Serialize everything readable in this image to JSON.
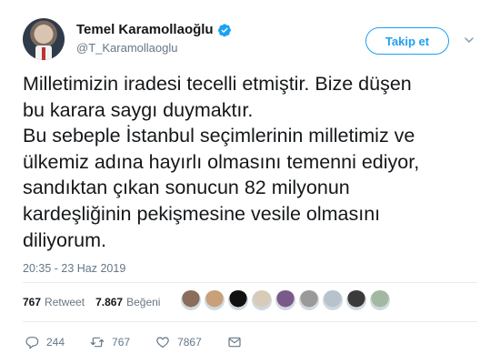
{
  "author": {
    "display_name": "Temel Karamollaoğlu",
    "handle": "@T_Karamollaoglu",
    "verified": true
  },
  "follow_button": {
    "label": "Takip et"
  },
  "tweet": {
    "lines": [
      "Milletimizin iradesi tecelli etmiştir. Bize düşen",
      "bu karara saygı duymaktır.",
      "Bu sebeple İstanbul seçimlerinin milletimiz ve",
      "ülkemiz adına hayırlı olmasını temenni ediyor,",
      "sandıktan çıkan sonucun 82 milyonun",
      "kardeşliğinin pekişmesine vesile olmasını",
      "diliyorum."
    ],
    "timestamp": "20:35 - 23 Haz 2019"
  },
  "stats": {
    "retweets_count": "767",
    "retweets_label": "Retweet",
    "likes_count": "7.867",
    "likes_label": "Beğeni"
  },
  "likers": [
    {
      "color": "#8a6d5a"
    },
    {
      "color": "#c9a07a"
    },
    {
      "color": "#111111"
    },
    {
      "color": "#d8cbb8"
    },
    {
      "color": "#7a5a8a"
    },
    {
      "color": "#9a9a9a"
    },
    {
      "color": "#b8c2cc"
    },
    {
      "color": "#3a3a3a"
    },
    {
      "color": "#a3b8a0"
    }
  ],
  "actions": {
    "reply_count": "244",
    "retweet_count": "767",
    "like_count": "7867"
  },
  "colors": {
    "accent": "#1da1f2",
    "text": "#14171a",
    "secondary": "#657786"
  },
  "icons": [
    "verified-badge-icon",
    "chevron-down-icon",
    "reply-icon",
    "retweet-icon",
    "heart-icon",
    "mail-icon"
  ]
}
